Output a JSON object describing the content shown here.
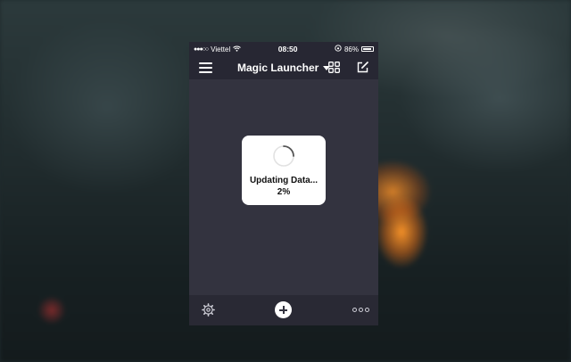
{
  "status_bar": {
    "carrier": "Viettel",
    "time": "08:50",
    "battery": "86%",
    "battery_level": 0.86,
    "signal_dots": "●●●○○"
  },
  "nav": {
    "title": "Magic Launcher",
    "left_icon": "hamburger-menu-icon",
    "right_icons": [
      "grid-icon",
      "edit-icon"
    ]
  },
  "hud": {
    "label": "Updating Data...",
    "percent": "2%",
    "progress": 0.02
  },
  "bottom_bar": {
    "icons": [
      "settings-icon",
      "add-icon",
      "more-icon"
    ]
  },
  "colors": {
    "screen_bg": "#33333f",
    "bar_bg": "#272733",
    "hud_bg": "#ffffff"
  }
}
